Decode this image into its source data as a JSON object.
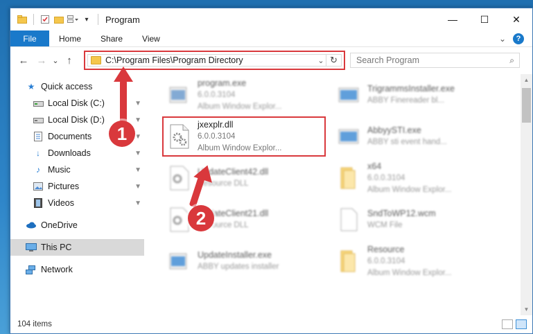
{
  "window": {
    "title": "Program"
  },
  "quick_access_toolbar": {
    "dropdown_icon": "chevron-down-icon"
  },
  "caption": {
    "minimize": "—",
    "maximize": "☐",
    "close": "✕"
  },
  "ribbon": {
    "tabs": [
      "File",
      "Home",
      "Share",
      "View"
    ],
    "expand_glyph": "⌄",
    "help_glyph": "?"
  },
  "nav": {
    "back": "←",
    "forward": "→",
    "recent": "⌄",
    "up": "↑"
  },
  "address": {
    "path": "C:\\Program Files\\Program Directory",
    "dropdown": "⌄",
    "refresh": "↻"
  },
  "search": {
    "placeholder": "Search Program",
    "icon": "⌕"
  },
  "sidebar": {
    "quick_access": "Quick access",
    "items": [
      {
        "label": "Local Disk (C:)",
        "icon": "drive-icon"
      },
      {
        "label": "Local Disk (D:)",
        "icon": "drive-icon"
      },
      {
        "label": "Documents",
        "icon": "documents-icon"
      },
      {
        "label": "Downloads",
        "icon": "downloads-icon"
      },
      {
        "label": "Music",
        "icon": "music-icon"
      },
      {
        "label": "Pictures",
        "icon": "pictures-icon"
      },
      {
        "label": "Videos",
        "icon": "videos-icon"
      }
    ],
    "onedrive": "OneDrive",
    "this_pc": "This PC",
    "network": "Network",
    "pin_glyph": "📌"
  },
  "files": [
    {
      "name": "program.exe",
      "sub": "6.0.0.3104",
      "sub2": "Album Window Explor...",
      "icon": "app-icon",
      "blurred": true
    },
    {
      "name": "jxexplr.dll",
      "sub": "6.0.0.3104",
      "sub2": "Album Window Explor...",
      "icon": "gear-file-icon",
      "blurred": false
    },
    {
      "name": "UpdateClient42.dll",
      "sub": "Resource DLL",
      "sub2": "",
      "icon": "gear-file-icon",
      "blurred": true
    },
    {
      "name": "UpdateClient21.dll",
      "sub": "Resource DLL",
      "sub2": "",
      "icon": "gear-file-icon",
      "blurred": true
    },
    {
      "name": "UpdateInstaller.exe",
      "sub": "ABBY updates installer",
      "sub2": "",
      "icon": "app-icon",
      "blurred": true
    },
    {
      "name": "TrigrammsInstaller.exe",
      "sub": "ABBY Finereader bl...",
      "sub2": "",
      "icon": "app-icon",
      "blurred": true
    },
    {
      "name": "AbbyySTI.exe",
      "sub": "ABBY sti event hand...",
      "sub2": "",
      "icon": "app-icon",
      "blurred": true
    },
    {
      "name": "x64",
      "sub": "6.0.0.3104",
      "sub2": "Album Window Explor...",
      "icon": "folder-icon",
      "blurred": true
    },
    {
      "name": "SndToWP12.wcm",
      "sub": "WCM File",
      "sub2": "",
      "icon": "file-icon",
      "blurred": true
    },
    {
      "name": "Resource",
      "sub": "6.0.0.3104",
      "sub2": "Album Window Explor...",
      "icon": "folder-icon",
      "blurred": true
    }
  ],
  "markers": [
    "1",
    "2"
  ],
  "status": {
    "count": "104 items"
  },
  "colors": {
    "accent": "#1979ca",
    "highlight": "#d9383c"
  }
}
